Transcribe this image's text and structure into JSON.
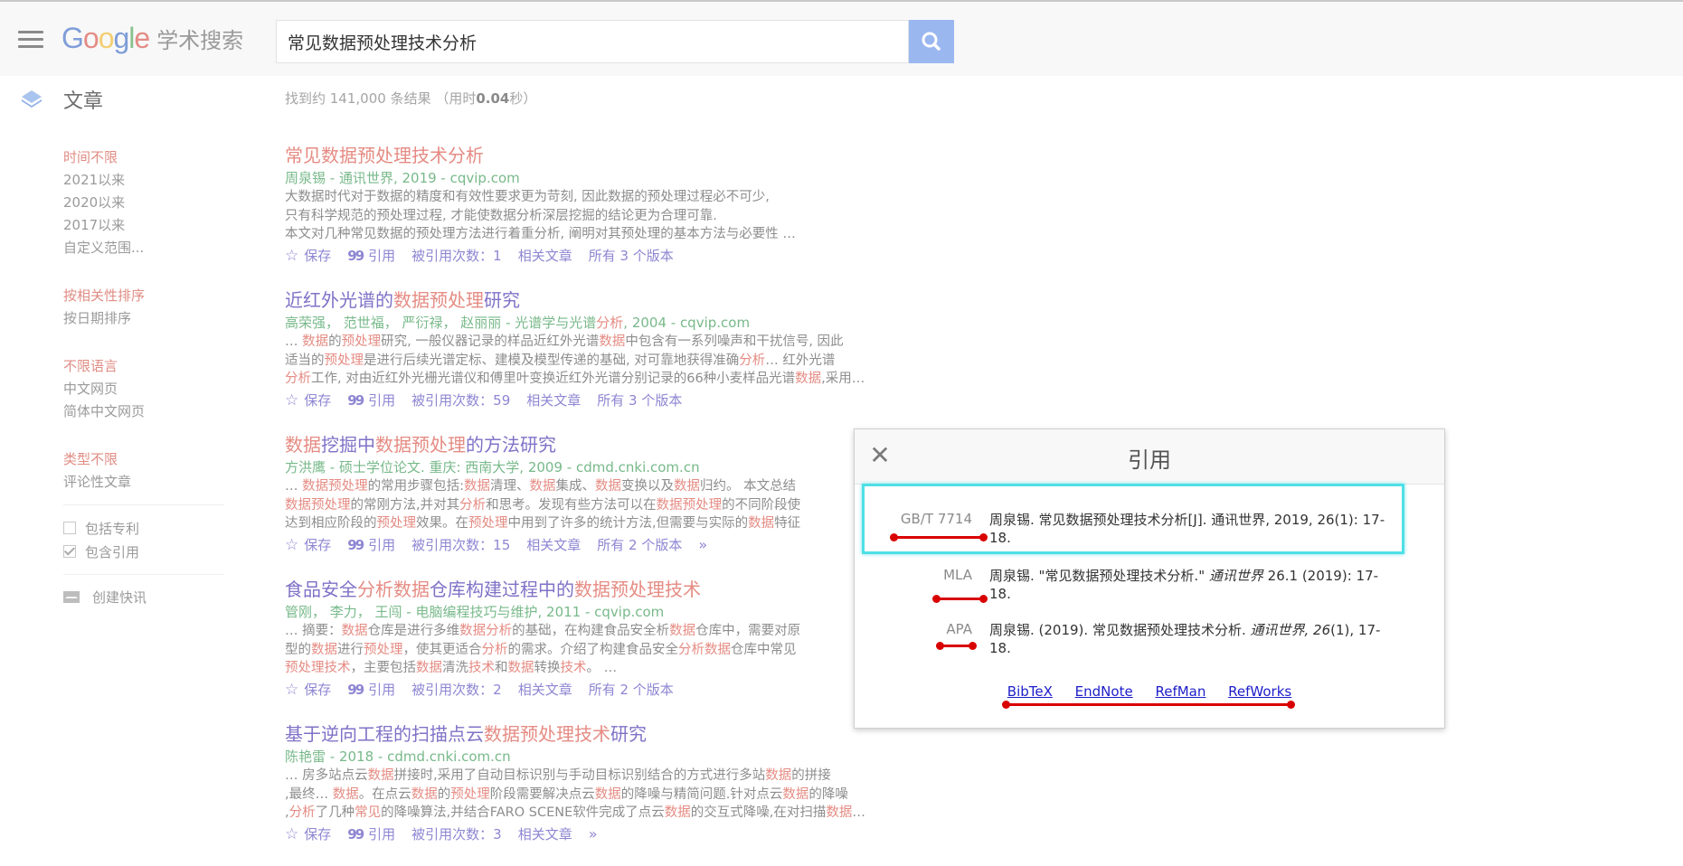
{
  "header": {
    "logo_google": "Google",
    "logo_sub": "学术搜索",
    "search_value": "常见数据预处理技术分析"
  },
  "subheader": {
    "section_label": "文章",
    "stats_prefix": "找到约 141,000 条结果 （用时",
    "stats_time": "0.04",
    "stats_suffix": "秒）"
  },
  "sidebar": {
    "time_filters": [
      "时间不限",
      "2021以来",
      "2020以来",
      "2017以来",
      "自定义范围..."
    ],
    "sort_options": [
      "按相关性排序",
      "按日期排序"
    ],
    "language_options": [
      "不限语言",
      "中文网页",
      "简体中文网页"
    ],
    "type_options": [
      "类型不限",
      "评论性文章"
    ],
    "include_patents": "包括专利",
    "include_citations": "包含引用",
    "create_alert": "创建快讯"
  },
  "actions": {
    "save": "保存",
    "cite": "引用"
  },
  "results": [
    {
      "meta": "周泉锡 - 通讯世界, 2019 - cqvip.com",
      "cited": "被引用次数：1",
      "related": "相关文章",
      "versions": "所有 3 个版本"
    },
    {
      "meta_authors": "高荣强，  范世福，  严衍禄，  赵丽丽 - 光谱学与光谱",
      "meta_hl": "分析",
      "meta_rest": ", 2004 - cqvip.com",
      "cited": "被引用次数：59",
      "related": "相关文章",
      "versions": "所有 3 个版本"
    },
    {
      "meta": "方洪鹰 - 硕士学位论文. 重庆: 西南大学, 2009 - cdmd.cnki.com.cn",
      "cited": "被引用次数：15",
      "related": "相关文章",
      "versions": "所有 2 个版本"
    },
    {
      "meta": "管刚，  李力，  王闯 - 电脑编程技巧与维护, 2011 - cqvip.com",
      "cited": "被引用次数：2",
      "related": "相关文章",
      "versions": "所有 2 个版本"
    },
    {
      "meta": "陈艳雷 - 2018 - cdmd.cnki.com.cn",
      "cited": "被引用次数：3",
      "related": "相关文章"
    }
  ],
  "dialog": {
    "title": "引用",
    "citations": [
      {
        "format": "GB/T 7714",
        "text": "周泉锡. 常见数据预处理技术分析[J]. 通讯世界, 2019, 26(1): 17-18."
      },
      {
        "format": "MLA",
        "text_a": "周泉锡. \"常见数据预处理技术分析.\" ",
        "journal": "通讯世界",
        "text_b": " 26.1 (2019): 17-18."
      },
      {
        "format": "APA",
        "text_a": "周泉锡. (2019). 常见数据预处理技术分析. ",
        "journal": "通讯世界, 26",
        "text_b": "(1), 17-18."
      }
    ],
    "exports": [
      "BibTeX",
      "EndNote",
      "RefMan",
      "RefWorks"
    ]
  },
  "colors": {
    "highlight": "#e58b83",
    "title_link": "#7f72c7",
    "meta_green": "#78b98a",
    "annotation_red": "#d90000",
    "annotation_cyan": "#4fe0e6"
  }
}
